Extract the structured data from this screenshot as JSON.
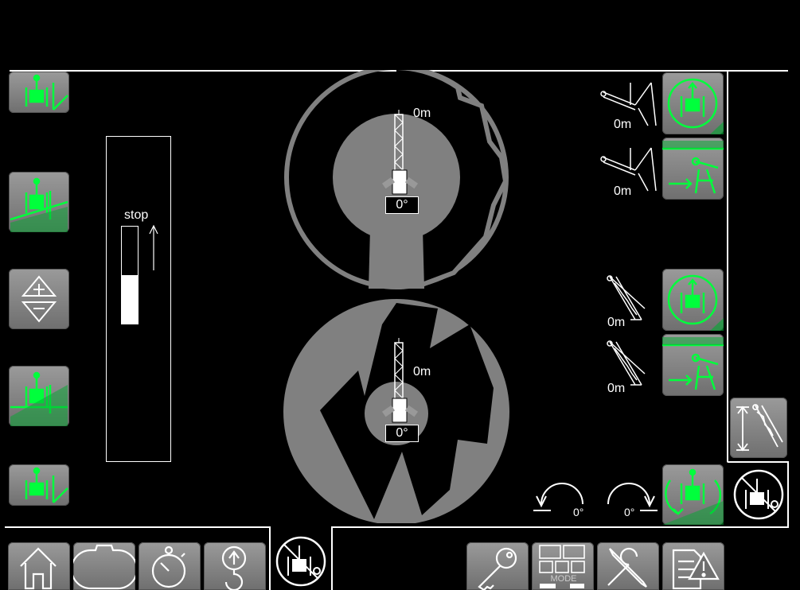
{
  "colors": {
    "accent": "#00ff3c",
    "panel": "#888888",
    "background": "#000000"
  },
  "upper_crane": {
    "distance": "0m",
    "angle": "0°"
  },
  "lower_crane": {
    "distance": "0m",
    "angle": "0°"
  },
  "speed_gauge": {
    "label": "stop",
    "level": 0.5
  },
  "right_panel": {
    "upper_row1_distance": "0m",
    "upper_row2_distance": "0m",
    "lower_row1_distance": "0m",
    "lower_row2_distance": "0m"
  },
  "rotation": {
    "left_angle": "0°",
    "right_angle": "0°"
  },
  "mode_label": "MODE",
  "icons": {
    "left": [
      "crane-track-icon",
      "crane-incline-icon",
      "plus-minus-icon",
      "crane-level-icon",
      "crane-track-icon"
    ],
    "bottom": [
      "home-icon",
      "blank-icon",
      "stopwatch-icon",
      "hook-icon",
      "crane-disabled-icon",
      "key-icon",
      "mode-icon",
      "tools-icon",
      "warning-document-icon"
    ]
  }
}
